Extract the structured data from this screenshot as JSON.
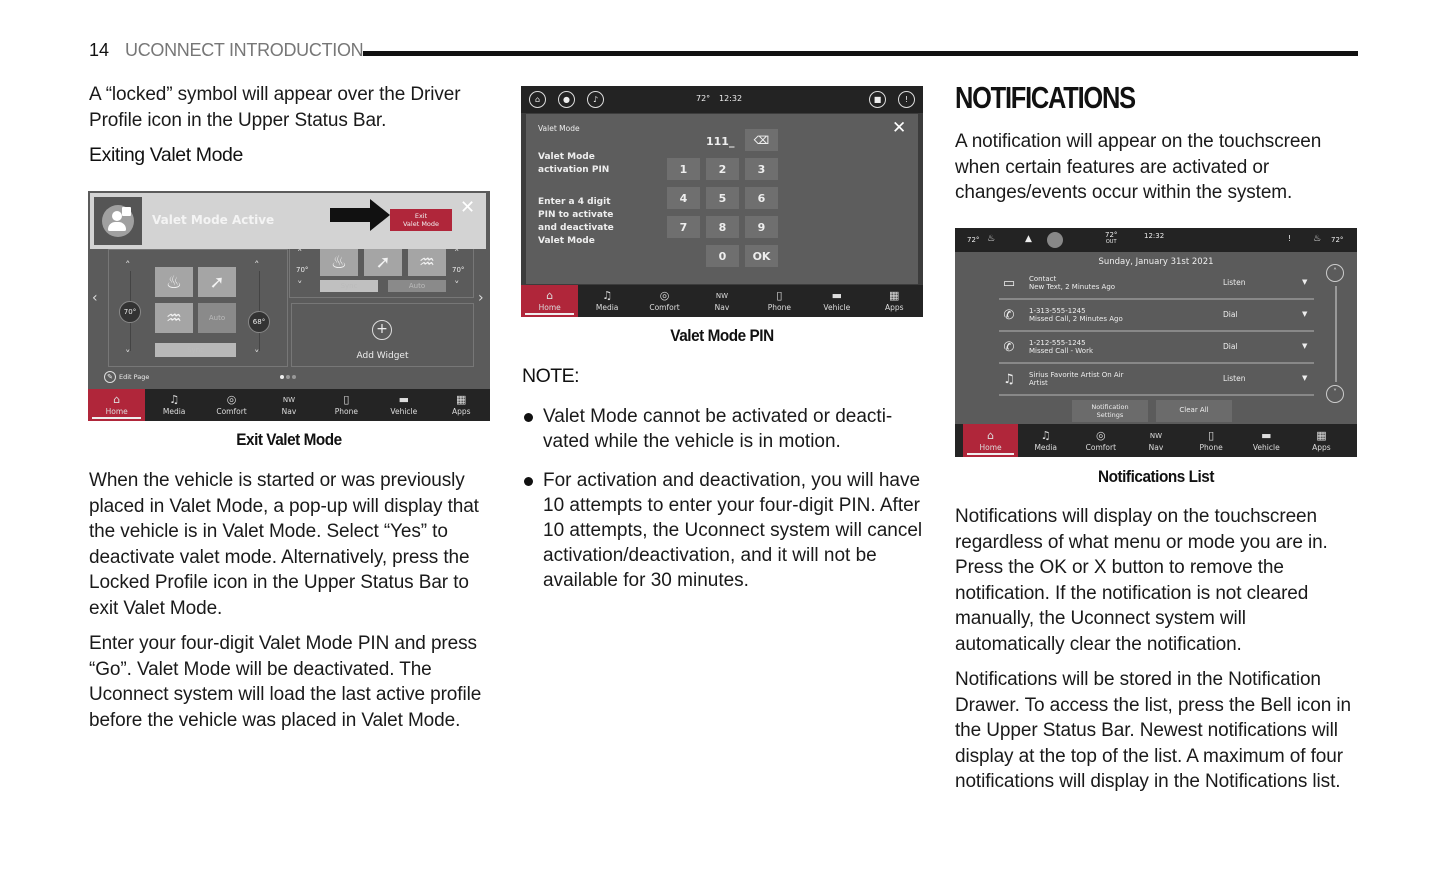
{
  "header": {
    "page_number": "14",
    "section": "UCONNECT INTRODUCTION"
  },
  "left_column": {
    "intro_text": "A “locked” symbol will appear over the Driver Profile icon in the Upper Status Bar.",
    "subheading": "Exiting Valet Mode",
    "figure_caption": "Exit Valet Mode",
    "paragraphs": [
      "When the vehicle is started or was previously placed in Valet Mode, a pop-up will display that the vehicle is in Valet Mode. Select “Yes” to deactivate valet mode. Alternatively, press the Locked Profile icon in the Upper Status Bar to exit Valet Mode.",
      "Enter your four-digit Valet Mode PIN and press “Go”. Valet Mode will be deactivated. The Uconnect system will load the last active profile before the vehicle was placed in Valet Mode."
    ]
  },
  "exit_valet_screen": {
    "banner_text": "Valet Mode Active",
    "exit_button_line1": "Exit",
    "exit_button_line2": "Valet Mode",
    "left_temp": "70°",
    "right_temp": "68°",
    "auto_label": "Auto",
    "sync_label": "Sync",
    "widget2_left_temp": "70°",
    "widget2_right_temp": "70°",
    "widget2_sync": "Sync",
    "widget2_auto": "Auto",
    "add_widget_label": "Add Widget",
    "edit_page_label": "Edit Page",
    "page_dots": 3,
    "active_page": 1
  },
  "nav": [
    {
      "label": "Home",
      "icon": "home-icon",
      "glyph": "⌂",
      "active": true
    },
    {
      "label": "Media",
      "icon": "music-note-icon",
      "glyph": "♫",
      "active": false
    },
    {
      "label": "Comfort",
      "icon": "comfort-icon",
      "glyph": "◎",
      "active": false
    },
    {
      "label": "Nav",
      "icon": "compass-nw-icon",
      "glyph": "NW",
      "active": false
    },
    {
      "label": "Phone",
      "icon": "phone-icon",
      "glyph": "▯",
      "active": false
    },
    {
      "label": "Vehicle",
      "icon": "vehicle-icon",
      "glyph": "▬",
      "active": false
    },
    {
      "label": "Apps",
      "icon": "apps-grid-icon",
      "glyph": "▦",
      "active": false
    }
  ],
  "pin_screen": {
    "status_temp": "72°",
    "status_time": "12:32",
    "panel_title": "Valet Mode",
    "pin_label_line1": "Valet Mode",
    "pin_label_line2": "activation PIN",
    "instr_lines": [
      "Enter a 4 digit",
      "PIN to activate",
      "and deactivate",
      "Valet Mode"
    ],
    "pin_value": "111_",
    "keys": [
      "1",
      "2",
      "3",
      "4",
      "5",
      "6",
      "7",
      "8",
      "9",
      "0",
      "OK"
    ],
    "caption": "Valet Mode PIN"
  },
  "note": {
    "label": "NOTE:",
    "items": [
      "Valet Mode cannot be activated or deacti-vated while the vehicle is in motion.",
      "For activation and deactivation, you will have 10 attempts to enter your four-digit PIN. After 10 attempts, the Uconnect system will cancel activation/deactivation, and it will not be available for 30 minutes."
    ]
  },
  "right_column": {
    "title": "NOTIFICATIONS",
    "intro": "A notification will appear on the touchscreen when certain features are activated or changes/events occur within the system.",
    "caption": "Notifications List",
    "paragraphs": [
      "Notifications will display on the touchscreen regardless of what menu or mode you are in. Press the OK or X button to remove the notification. If the notification is not cleared manually, the Uconnect system will automatically clear the notification.",
      "Notifications will be stored in the Notification Drawer. To access the list, press the Bell icon in the Upper Status Bar. Newest notifications will display at the top of the list. A maximum of four notifications will display in the Notifications list."
    ]
  },
  "notif_screen": {
    "left_temp": "72°",
    "out_temp": "72°",
    "out_label": "OUT",
    "time": "12:32",
    "right_temp": "72°",
    "date": "Sunday, January 31st 2021",
    "rows": [
      {
        "icon": "message-icon",
        "glyph": "▭",
        "line1": "Contact",
        "line2": "New Text, 2 Minutes Ago",
        "action": "Listen"
      },
      {
        "icon": "missed-call-icon",
        "glyph": "✆",
        "line1": "1-313-555-1245",
        "line2": "Missed Call, 2 Minutes Ago",
        "action": "Dial"
      },
      {
        "icon": "missed-call-icon",
        "glyph": "✆",
        "line1": "1-212-555-1245",
        "line2": "Missed Call - Work",
        "action": "Dial"
      },
      {
        "icon": "music-note-icon",
        "glyph": "♫",
        "line1": "Sirius Favorite Artist On Air",
        "line2": "Artist",
        "action": "Listen"
      }
    ],
    "settings_line1": "Notification",
    "settings_line2": "Settings",
    "clear_all": "Clear All"
  }
}
